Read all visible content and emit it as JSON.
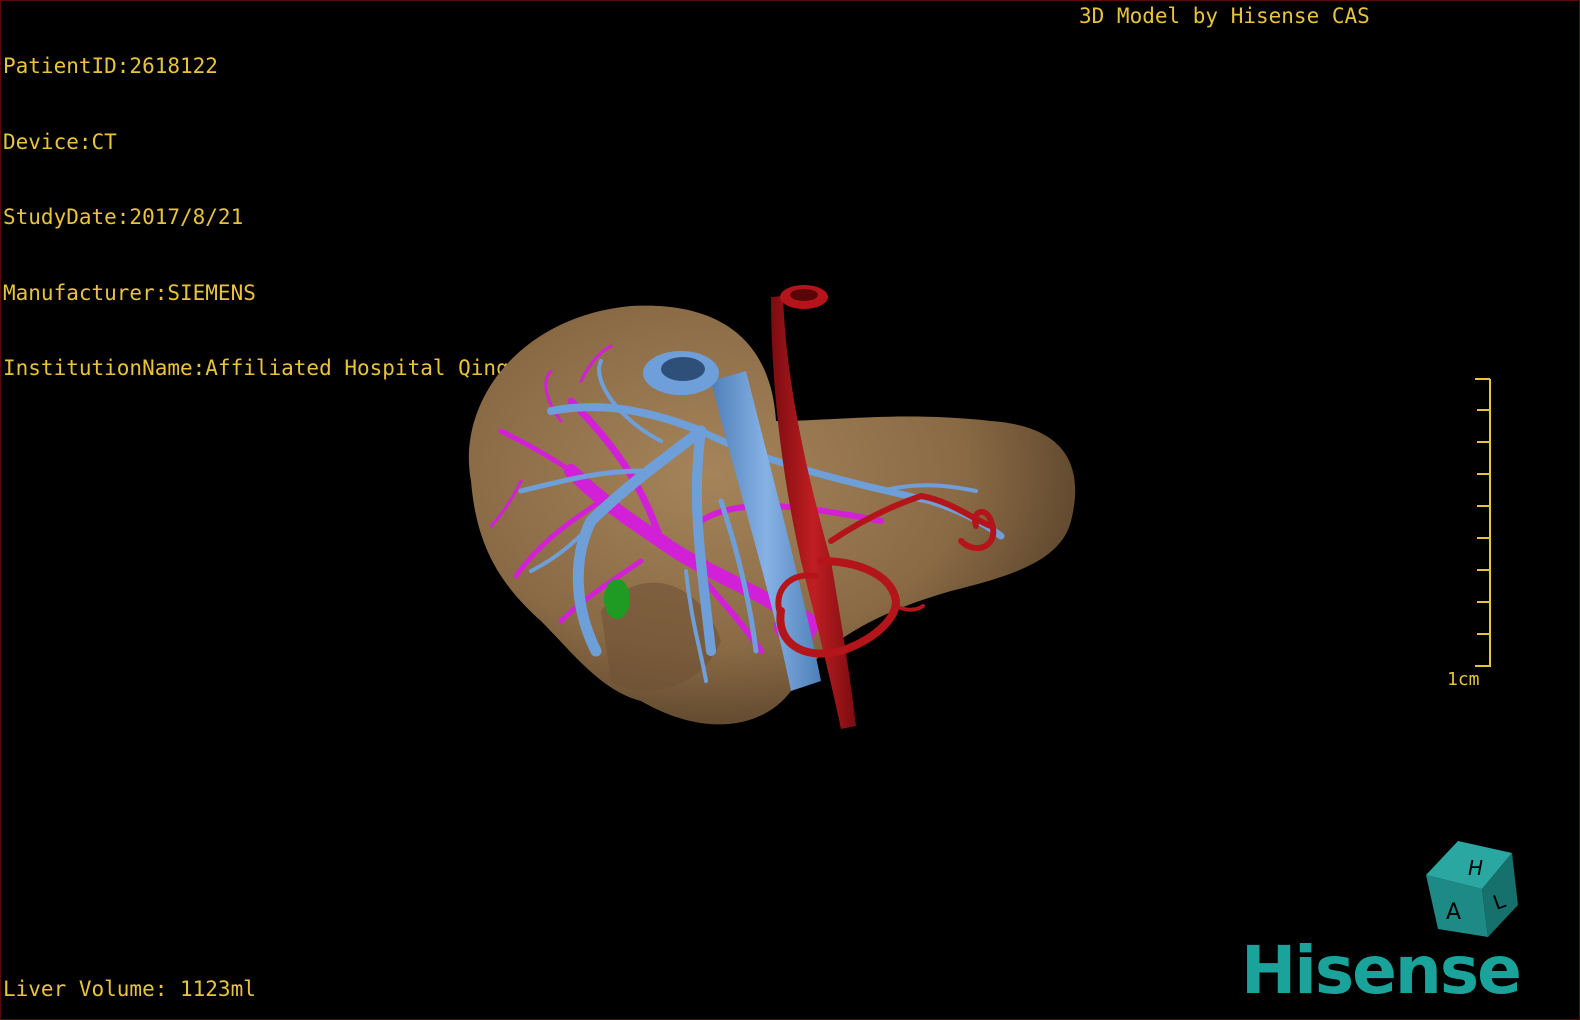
{
  "patient_info": {
    "patient_id": "PatientID:2618122",
    "device": "Device:CT",
    "study_date": "StudyDate:2017/8/21",
    "manufacturer": "Manufacturer:SIEMENS",
    "institution": "InstitutionName:Affiliated Hospital Qingdao University-C"
  },
  "model_credit": "3D Model by Hisense CAS",
  "liver_volume": "Liver Volume: 1123ml",
  "scale": {
    "label": "1cm",
    "ticks": 10
  },
  "orientation_cube": {
    "labels": [
      "H",
      "A",
      "L"
    ],
    "color": "#1e8a86"
  },
  "brand": {
    "name": "Hisense",
    "color": "#1aa39a"
  },
  "colors": {
    "overlay_text": "#e8c43a",
    "liver": "#8a6a45",
    "hepatic_vein": "#6f9fd8",
    "portal_vein": "#d21fd8",
    "artery": "#b3151a",
    "lesion": "#1f9a22",
    "frame_border": "#5a0a0a"
  },
  "icons": [
    "orientation-cube-icon",
    "scale-bar-icon"
  ]
}
